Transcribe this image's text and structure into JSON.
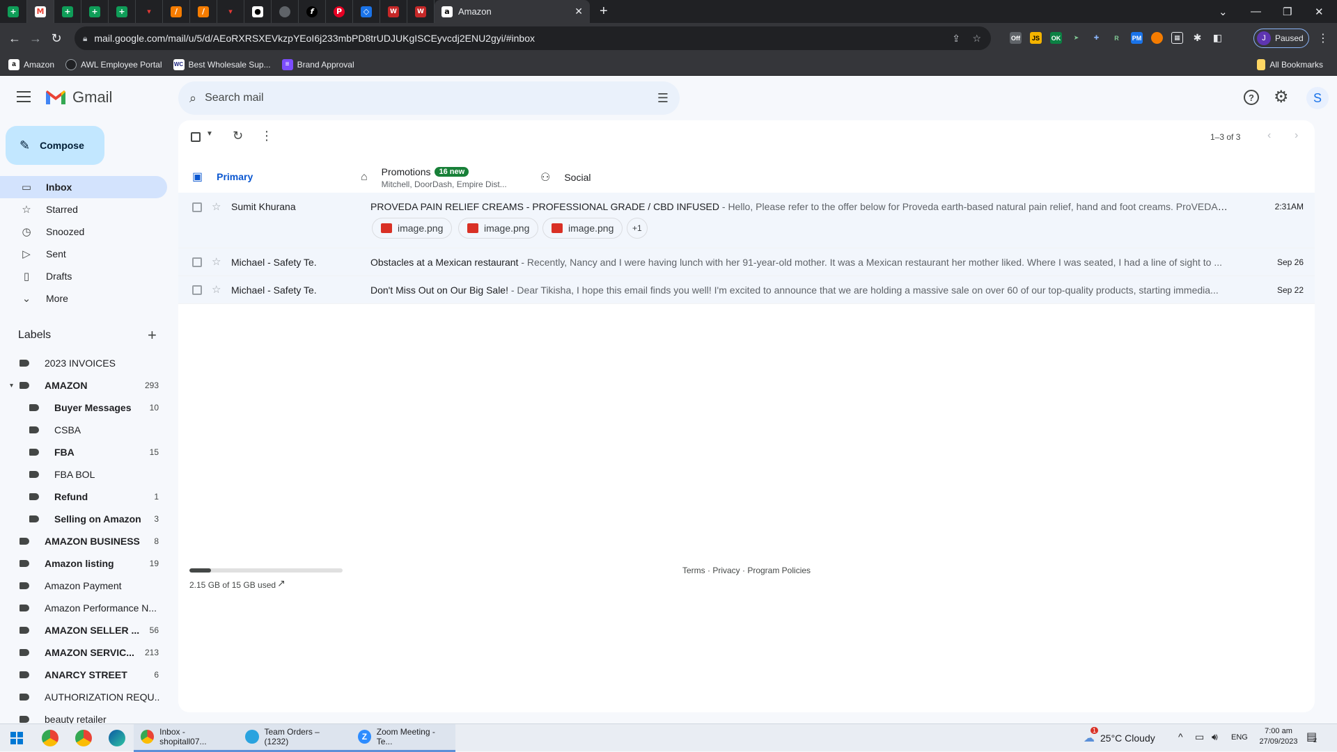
{
  "browser": {
    "active_tab_title": "Amazon",
    "url": "mail.google.com/mail/u/5/d/AEoRXRSXEVkzpYEoI6j233mbPD8trUDJUKgISCEyvcdj2ENU2gyi/#inbox",
    "profile_initial": "J",
    "profile_status": "Paused",
    "bookmarks": [
      "Amazon",
      "AWL Employee Portal",
      "Best Wholesale Sup...",
      "Brand Approval"
    ],
    "all_bookmarks_label": "All Bookmarks",
    "extension_badges": [
      "Off",
      "JS",
      "OK",
      "R",
      "PM"
    ]
  },
  "gmail": {
    "product_name": "Gmail",
    "search_placeholder": "Search mail",
    "account_initial": "S",
    "compose_label": "Compose",
    "nav": [
      {
        "label": "Inbox",
        "icon": "inbox-icon",
        "active": true
      },
      {
        "label": "Starred",
        "icon": "star-icon"
      },
      {
        "label": "Snoozed",
        "icon": "clock-icon"
      },
      {
        "label": "Sent",
        "icon": "send-icon"
      },
      {
        "label": "Drafts",
        "icon": "draft-icon"
      },
      {
        "label": "More",
        "icon": "chevron-down-icon"
      }
    ],
    "labels_heading": "Labels",
    "labels": [
      {
        "name": "2023 INVOICES",
        "count": "",
        "bold": false,
        "indent": 0
      },
      {
        "name": "AMAZON",
        "count": "293",
        "bold": true,
        "indent": 0,
        "expanded": true
      },
      {
        "name": "Buyer Messages",
        "count": "10",
        "bold": true,
        "indent": 1
      },
      {
        "name": "CSBA",
        "count": "",
        "bold": false,
        "indent": 1
      },
      {
        "name": "FBA",
        "count": "15",
        "bold": true,
        "indent": 1
      },
      {
        "name": "FBA BOL",
        "count": "",
        "bold": false,
        "indent": 1
      },
      {
        "name": "Refund",
        "count": "1",
        "bold": true,
        "indent": 1
      },
      {
        "name": "Selling on Amazon",
        "count": "3",
        "bold": true,
        "indent": 1
      },
      {
        "name": "AMAZON BUSINESS",
        "count": "8",
        "bold": true,
        "indent": 0
      },
      {
        "name": "Amazon listing",
        "count": "19",
        "bold": true,
        "indent": 0
      },
      {
        "name": "Amazon Payment",
        "count": "",
        "bold": false,
        "indent": 0
      },
      {
        "name": "Amazon Performance N...",
        "count": "",
        "bold": false,
        "indent": 0
      },
      {
        "name": "AMAZON SELLER ...",
        "count": "56",
        "bold": true,
        "indent": 0
      },
      {
        "name": "AMAZON SERVIC...",
        "count": "213",
        "bold": true,
        "indent": 0
      },
      {
        "name": "ANARCY STREET",
        "count": "6",
        "bold": true,
        "indent": 0
      },
      {
        "name": "AUTHORIZATION REQU...",
        "count": "",
        "bold": false,
        "indent": 0
      },
      {
        "name": "beauty retailer",
        "count": "",
        "bold": false,
        "indent": 0
      }
    ],
    "pagination": "1–3 of 3",
    "tabs": [
      {
        "label": "Primary",
        "icon": "inbox-icon",
        "active": true
      },
      {
        "label": "Promotions",
        "icon": "tag-icon",
        "badge": "16 new",
        "sub": "Mitchell, DoorDash, Empire Dist..."
      },
      {
        "label": "Social",
        "icon": "people-icon"
      }
    ],
    "emails": [
      {
        "sender": "Sumit Khurana",
        "subject": "PROVEDA PAIN RELIEF CREAMS - PROFESSIONAL GRADE / CBD INFUSED",
        "snippet": " - Hello, Please refer to the offer below for Proveda earth-based natural pain relief, hand and foot creams. ProVEDA® MA...",
        "date": "2:31AM",
        "attachments": [
          "image.png",
          "image.png",
          "image.png"
        ],
        "more_attachments": "+1"
      },
      {
        "sender": "Michael - Safety Te.",
        "subject": "Obstacles at a Mexican restaurant",
        "snippet": " - Recently, Nancy and I were having lunch with her 91-year-old mother. It was a Mexican restaurant her mother liked. Where I was seated, I had a line of sight to ...",
        "date": "Sep 26"
      },
      {
        "sender": "Michael - Safety Te.",
        "subject": "Don't Miss Out on Our Big Sale!",
        "snippet": " - Dear Tikisha, I hope this email finds you well! I'm excited to announce that we are holding a massive sale on over 60 of our top-quality products, starting immedia...",
        "date": "Sep 22"
      }
    ],
    "storage_text": "2.15 GB of 15 GB used",
    "storage_fraction": 0.143,
    "footer_links": "Terms · Privacy · Program Policies"
  },
  "taskbar": {
    "apps": [
      {
        "label": "Inbox - shopitall07..."
      },
      {
        "label": "Team Orders – (1232)"
      },
      {
        "label": "Zoom Meeting - Te..."
      }
    ],
    "weather_badge": "1",
    "weather": "25°C  Cloudy",
    "lang": "ENG",
    "time": "7:00 am",
    "date": "27/09/2023",
    "notifications": "2"
  }
}
